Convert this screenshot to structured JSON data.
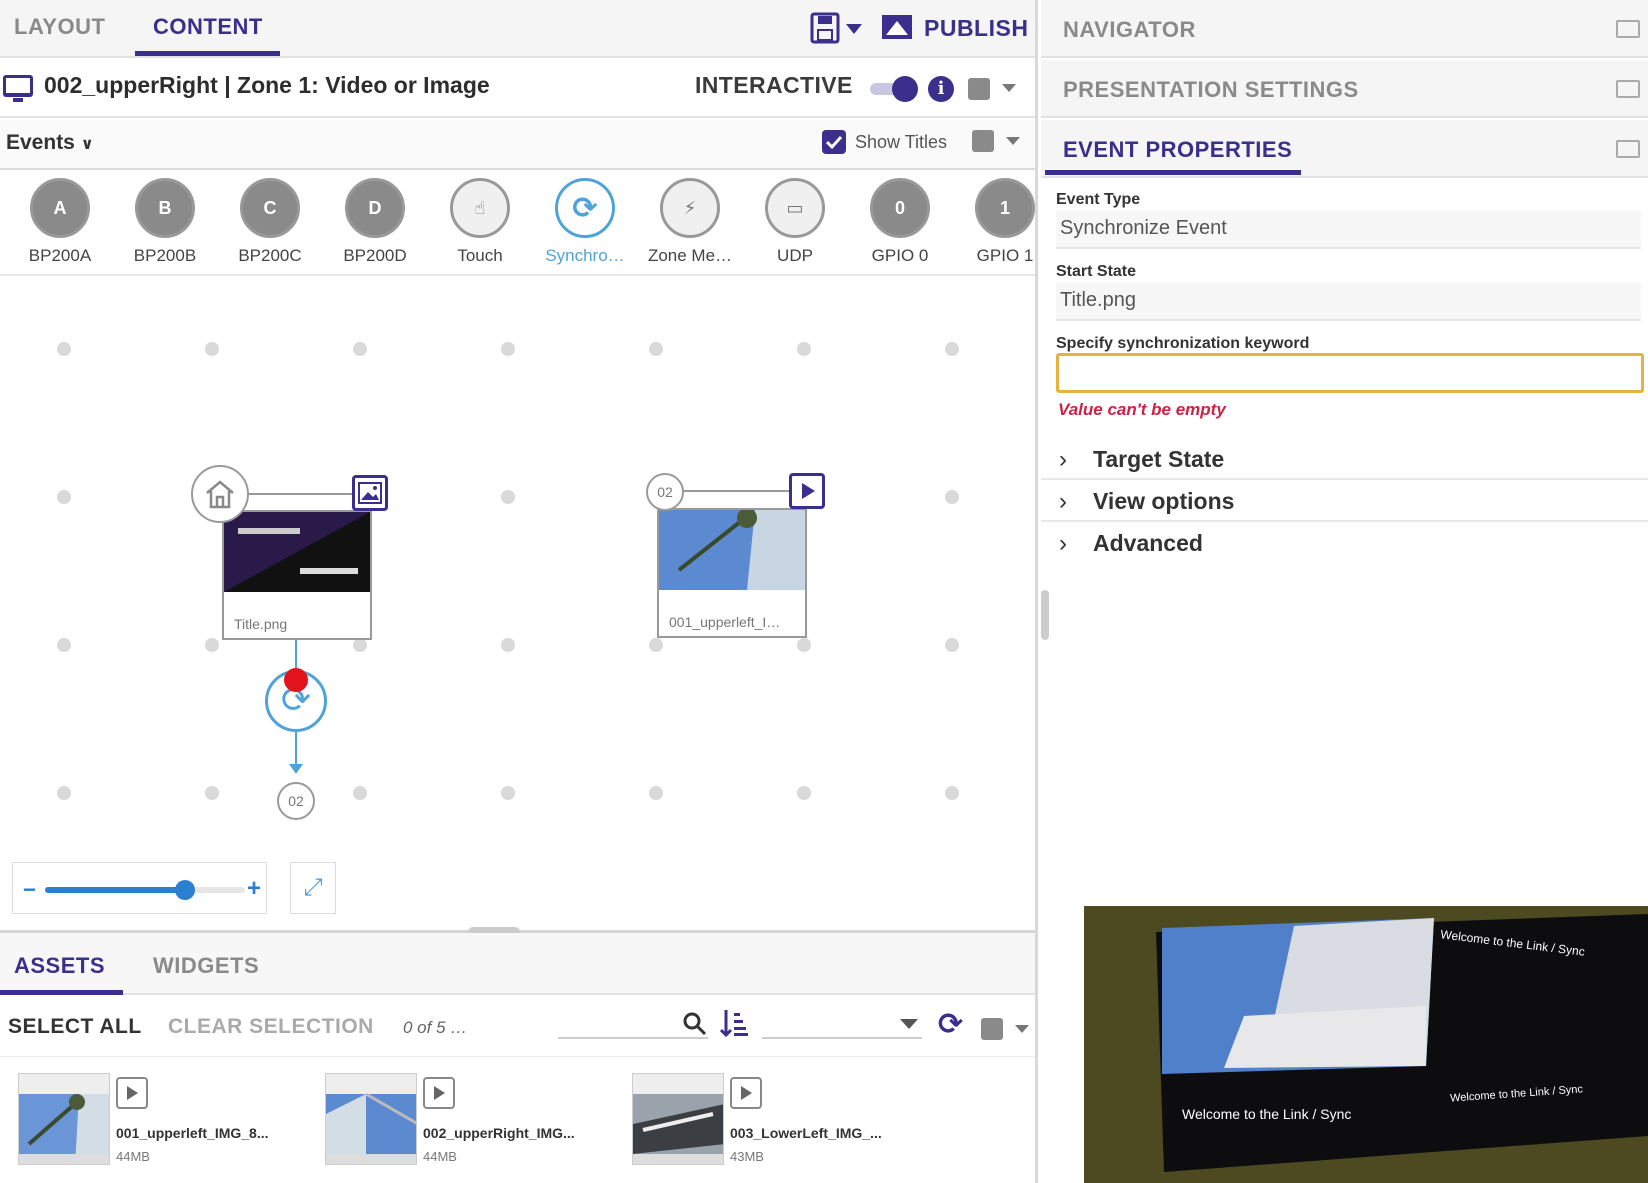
{
  "main_tabs": [
    {
      "label": "LAYOUT",
      "active": false
    },
    {
      "label": "CONTENT",
      "active": true
    }
  ],
  "publish_label": "PUBLISH",
  "zone": {
    "title": "002_upperRight | Zone 1: Video or Image",
    "mode_label": "INTERACTIVE",
    "mode_on": true
  },
  "events_toolbar": {
    "dropdown_label": "Events",
    "show_titles_label": "Show Titles",
    "show_titles_checked": true
  },
  "events": [
    {
      "label": "BP200A",
      "icon": "bp200-icon",
      "glyph": "A"
    },
    {
      "label": "BP200B",
      "icon": "bp200-icon",
      "glyph": "B"
    },
    {
      "label": "BP200C",
      "icon": "bp200-icon",
      "glyph": "C"
    },
    {
      "label": "BP200D",
      "icon": "bp200-icon",
      "glyph": "D"
    },
    {
      "label": "Touch",
      "icon": "touch-icon",
      "glyph": "☝"
    },
    {
      "label": "Synchro…",
      "icon": "sync-icon",
      "glyph": "⟳",
      "selected": true
    },
    {
      "label": "Zone Me…",
      "icon": "zone-message-icon",
      "glyph": "⚡"
    },
    {
      "label": "UDP",
      "icon": "udp-icon",
      "glyph": "▭"
    },
    {
      "label": "GPIO 0",
      "icon": "gpio-icon",
      "glyph": "0"
    },
    {
      "label": "GPIO 1",
      "icon": "gpio-icon",
      "glyph": "1"
    }
  ],
  "states": [
    {
      "label": "Title.png",
      "badge": "home-icon",
      "type": "image-icon"
    },
    {
      "label": "001_upperleft_I…",
      "badge": "02",
      "type": "video-icon"
    }
  ],
  "flow_target_badge": "02",
  "zoom_level": 0.7,
  "bottom_tabs": [
    {
      "label": "ASSETS",
      "active": true
    },
    {
      "label": "WIDGETS",
      "active": false
    }
  ],
  "asset_toolbar": {
    "select_all": "SELECT ALL",
    "clear_selection": "CLEAR SELECTION",
    "count": "0 of 5 …"
  },
  "assets": [
    {
      "name": "001_upperleft_IMG_8...",
      "size": "44MB"
    },
    {
      "name": "002_upperRight_IMG...",
      "size": "44MB"
    },
    {
      "name": "003_LowerLeft_IMG_...",
      "size": "43MB"
    }
  ],
  "right_panel": {
    "sections": [
      {
        "label": "NAVIGATOR",
        "active": false
      },
      {
        "label": "PRESENTATION SETTINGS",
        "active": false
      },
      {
        "label": "EVENT PROPERTIES",
        "active": true
      }
    ],
    "event_type_label": "Event Type",
    "event_type_value": "Synchronize Event",
    "start_state_label": "Start State",
    "start_state_value": "Title.png",
    "keyword_label": "Specify synchronization keyword",
    "keyword_value": "",
    "error_text": "Value can't be empty",
    "expanders": [
      "Target State",
      "View options",
      "Advanced"
    ]
  },
  "video_overlay": {
    "texts": [
      "Welcome to the Link / Sync",
      "Welcome to the Link / Sync",
      "Welcome to the Link / Sync"
    ]
  },
  "colors": {
    "accent": "#3a2f8c",
    "sync_blue": "#4fa3d8",
    "error": "#cc2244",
    "warning_border": "#e7b143"
  }
}
